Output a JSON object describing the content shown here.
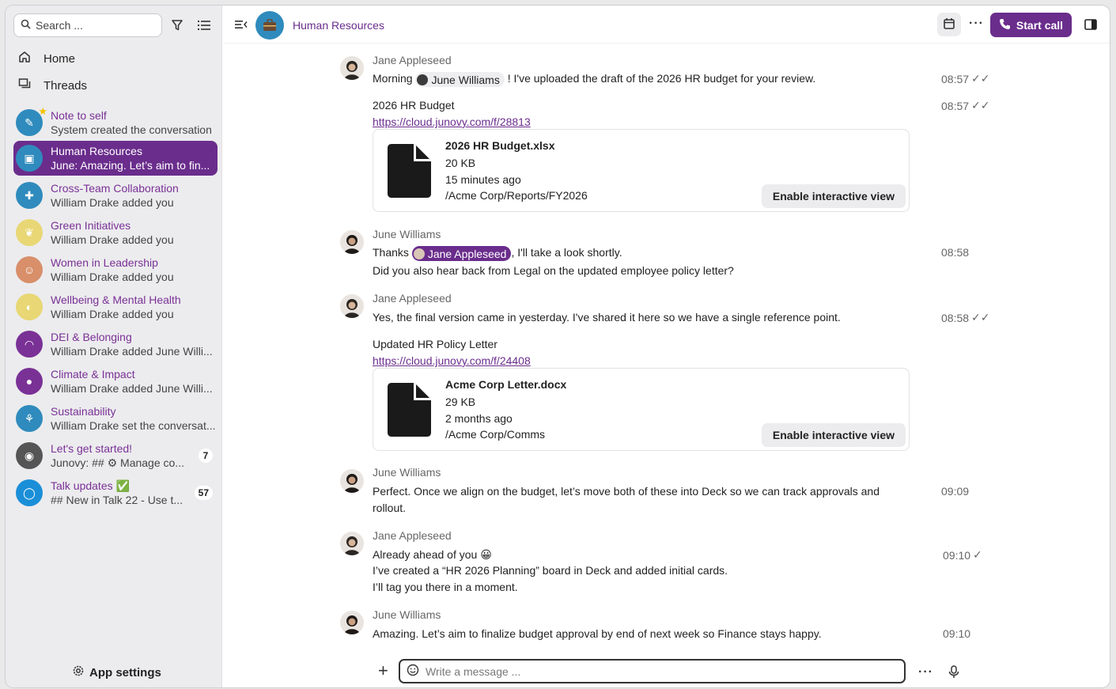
{
  "sidebar": {
    "search_placeholder": "Search ...",
    "nav": [
      {
        "label": "Home",
        "icon": "home-icon"
      },
      {
        "label": "Threads",
        "icon": "threads-icon"
      }
    ],
    "conversations": [
      {
        "name": "Note to self",
        "sub": "System created the conversation",
        "color": "#2f8bbd",
        "active": false,
        "badge": ""
      },
      {
        "name": "Human Resources",
        "sub": "June: Amazing. Let’s aim to fin...",
        "color": "#2f8bbd",
        "active": true,
        "badge": ""
      },
      {
        "name": "Cross-Team Collaboration",
        "sub": "William Drake added you",
        "color": "#2f8bbd",
        "active": false,
        "badge": ""
      },
      {
        "name": "Green Initiatives",
        "sub": "William Drake added you",
        "color": "#e8d774",
        "active": false,
        "badge": ""
      },
      {
        "name": "Women in Leadership",
        "sub": "William Drake added you",
        "color": "#d88f6a",
        "active": false,
        "badge": ""
      },
      {
        "name": "Wellbeing & Mental Health",
        "sub": "William Drake added you",
        "color": "#e8d774",
        "active": false,
        "badge": ""
      },
      {
        "name": "DEI & Belonging",
        "sub": "William Drake added June Willi...",
        "color": "#7a3196",
        "active": false,
        "badge": ""
      },
      {
        "name": "Climate & Impact",
        "sub": "William Drake added June Willi...",
        "color": "#7a3196",
        "active": false,
        "badge": ""
      },
      {
        "name": "Sustainability",
        "sub": "William Drake set the conversat...",
        "color": "#2f8bbd",
        "active": false,
        "badge": ""
      },
      {
        "name": "Let's get started!",
        "sub": "Junovy: ## ⚙ Manage co...",
        "color": "#555555",
        "active": false,
        "badge": "7"
      },
      {
        "name": "Talk updates ✅",
        "sub": "## New in Talk 22 - Use t...",
        "color": "#1a8fd8",
        "active": false,
        "badge": "57"
      }
    ],
    "app_settings": "App settings"
  },
  "header": {
    "title": "Human Resources",
    "start_call": "Start call"
  },
  "messages": {
    "m1_author": "Jane Appleseed",
    "m1_pre": "Morning",
    "m1_mention": "June Williams",
    "m1_post": "! I've uploaded the draft of the 2026 HR budget for your review.",
    "m1_time": "08:57",
    "m2_text": "2026 HR Budget",
    "m2_link": "https://cloud.junovy.com/f/28813",
    "m2_time": "08:57",
    "file1": {
      "name": "2026 HR Budget.xlsx",
      "size": "20 KB",
      "age": "15 minutes ago",
      "path": "/Acme Corp/Reports/FY2026",
      "action": "Enable interactive view"
    },
    "m3_author": "June Williams",
    "m3_pre": "Thanks",
    "m3_mention": "Jane Appleseed",
    "m3_post": ", I'll take a look shortly.",
    "m3_line2": "Did you also hear back from Legal on the updated employee policy letter?",
    "m3_time": "08:58",
    "m4_author": "Jane Appleseed",
    "m4_text": "Yes, the final version came in yesterday. I've shared it here so we have a single reference point.",
    "m4_time": "08:58",
    "m5_text": "Updated HR Policy Letter",
    "m5_link": "https://cloud.junovy.com/f/24408",
    "file2": {
      "name": "Acme Corp Letter.docx",
      "size": "29 KB",
      "age": "2 months ago",
      "path": "/Acme Corp/Comms",
      "action": "Enable interactive view"
    },
    "m6_author": "June Williams",
    "m6_line1": "Perfect. Once we align on the budget, let’s move both of these into Deck so we can track approvals and",
    "m6_line2": "rollout.",
    "m6_time": "09:09",
    "m7_author": "Jane Appleseed",
    "m7_line1": "Already ahead of you 😀",
    "m7_line2": "I’ve created a “HR 2026 Planning” board in Deck and added initial cards.",
    "m7_line3": "I’ll tag you there in a moment.",
    "m7_time": "09:10",
    "m8_author": "June Williams",
    "m8_text": "Amazing. Let’s aim to finalize budget approval by end of next week so Finance stays happy.",
    "m8_time": "09:10"
  },
  "composer": {
    "placeholder": "Write a message ..."
  },
  "colors": {
    "accent": "#6a2d8c",
    "sidebar_bg": "#ececee"
  }
}
